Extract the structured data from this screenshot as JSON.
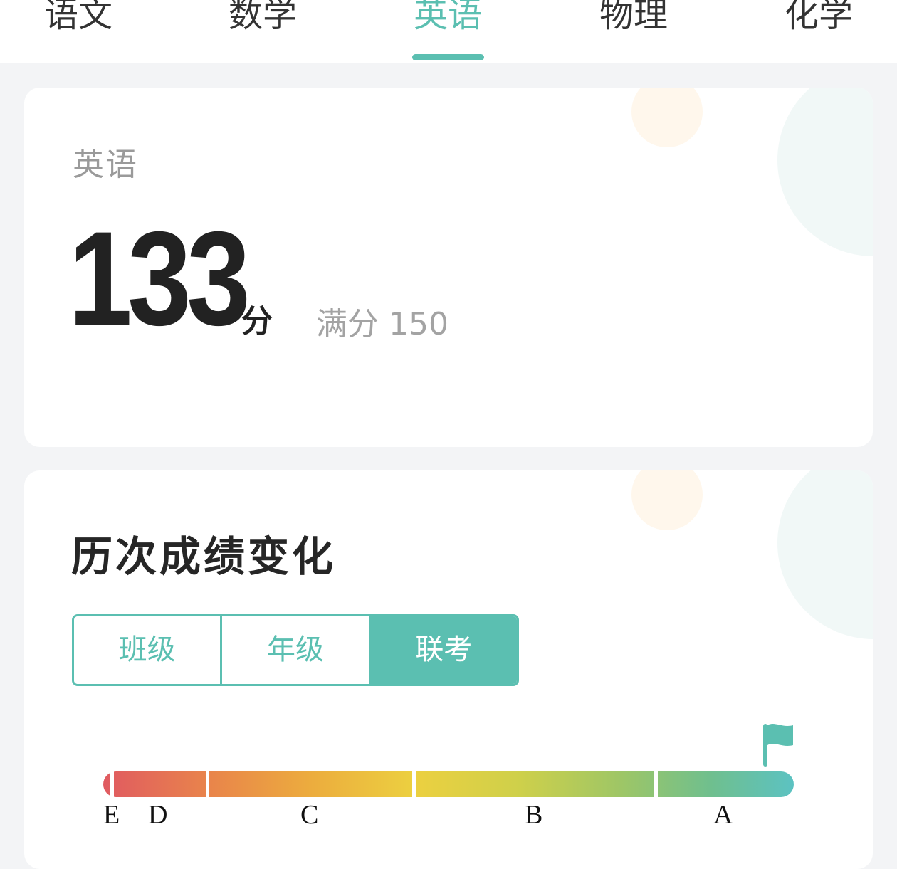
{
  "tabs": [
    {
      "label": "语文",
      "active": false
    },
    {
      "label": "数学",
      "active": false
    },
    {
      "label": "英语",
      "active": true
    },
    {
      "label": "物理",
      "active": false
    },
    {
      "label": "化学",
      "active": false
    }
  ],
  "score_card": {
    "subject": "英语",
    "score": "133",
    "unit": "分",
    "full_score_text": "满分 150"
  },
  "history": {
    "title": "历次成绩变化",
    "segments": [
      {
        "label": "班级",
        "active": false
      },
      {
        "label": "年级",
        "active": false
      },
      {
        "label": "联考",
        "active": true
      }
    ],
    "grade_labels": [
      "E",
      "D",
      "C",
      "B",
      "A"
    ],
    "current_grade": "A"
  },
  "colors": {
    "accent": "#5bbfb1",
    "gradient_start": "#e05a61",
    "gradient_end": "#5cc2c2"
  }
}
